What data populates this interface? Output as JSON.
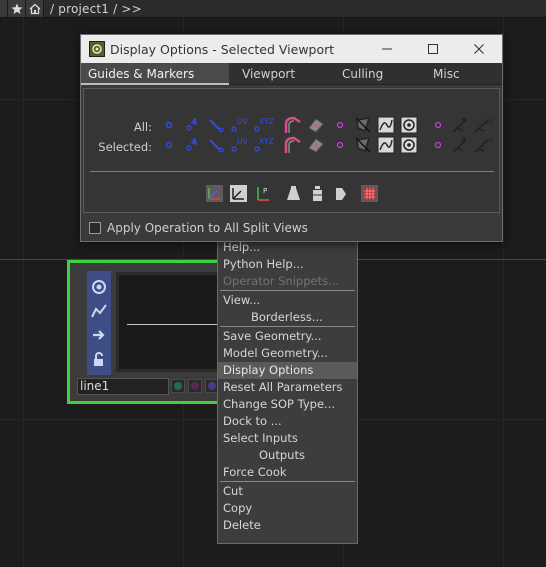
{
  "pathbar": {
    "star_icon": "star-icon",
    "home_icon": "home-icon",
    "path": "/ project1 / >>"
  },
  "node": {
    "name": "line1",
    "strip_icons": [
      "target-icon",
      "graph-icon",
      "arrow-right-icon",
      "lock-icon"
    ],
    "flag_colors": [
      "#1f6e4a",
      "#5a2a4a",
      "#4a3b8a"
    ]
  },
  "context_menu": {
    "items": [
      {
        "label": "Help...",
        "type": "item"
      },
      {
        "label": "Python Help...",
        "type": "item"
      },
      {
        "label": "Operator Snippets...",
        "type": "disabled"
      },
      {
        "label": "View...",
        "type": "item"
      },
      {
        "label": "Borderless...",
        "type": "indent1"
      },
      {
        "label": "Save Geometry...",
        "type": "item"
      },
      {
        "label": "Model Geometry...",
        "type": "item"
      },
      {
        "label": "Display Options",
        "type": "highlight"
      },
      {
        "label": "Reset All Parameters",
        "type": "item"
      },
      {
        "label": "Change SOP Type...",
        "type": "item"
      },
      {
        "label": "Dock to ...",
        "type": "item"
      },
      {
        "label": "Select Inputs",
        "type": "item"
      },
      {
        "label": "Outputs",
        "type": "indent2"
      },
      {
        "label": "Force Cook",
        "type": "item"
      },
      {
        "label": "Cut",
        "type": "item"
      },
      {
        "label": "Copy",
        "type": "item"
      },
      {
        "label": "Delete",
        "type": "item"
      }
    ]
  },
  "dialog": {
    "title": "Display Options - Selected Viewport",
    "minimize_icon": "minimize-icon",
    "maximize_icon": "maximize-icon",
    "close_icon": "close-icon",
    "tabs": [
      "Guides & Markers",
      "Viewport",
      "Culling",
      "Misc"
    ],
    "active_tab": "Guides & Markers",
    "rows": {
      "all_label": "All:",
      "selected_label": "Selected:"
    },
    "marker_texts": {
      "four": "4",
      "uv": "UV",
      "xyz": "XYZ",
      "p": "P"
    },
    "apply_all_label": "Apply Operation to All Split Views",
    "apply_all_checked": false
  },
  "colors": {
    "node_border": "#3fd23f",
    "highlight": "#5a5a5a",
    "accent_blue": "#3d4e86",
    "marker_blue": "#2e4cf0",
    "marker_magenta": "#c43fd6",
    "marker_pink": "#d84c8c"
  }
}
